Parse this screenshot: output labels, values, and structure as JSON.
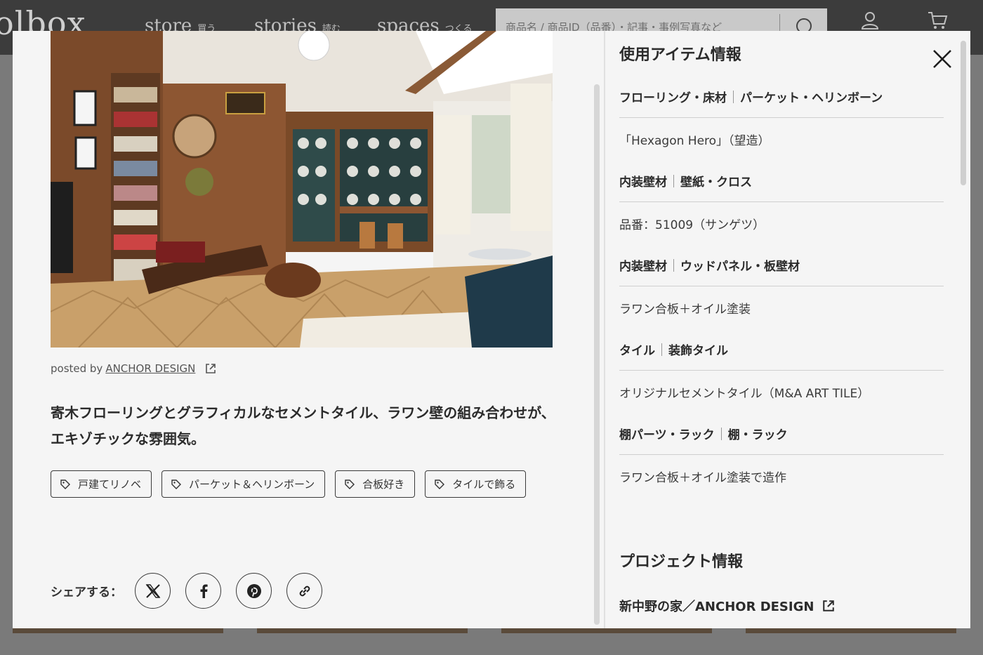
{
  "site": {
    "logo": "olbox",
    "nav": [
      {
        "label": "store",
        "sub": "買う"
      },
      {
        "label": "stories",
        "sub": "読む"
      },
      {
        "label": "spaces",
        "sub": "つくる"
      }
    ],
    "search_placeholder": "商品名 / 商品ID（品番）・記事・事例写真など",
    "icons": [
      "search-icon",
      "user-icon",
      "cart-icon"
    ]
  },
  "post": {
    "posted_prefix": "posted by",
    "author": "ANCHOR DESIGN",
    "caption": "寄木フローリングとグラフィカルなセメントタイル、ラワン壁の組み合わせが、エキゾチックな雰囲気。",
    "tags": [
      "戸建てリノベ",
      "パーケット＆ヘリンボーン",
      "合板好き",
      "タイルで飾る"
    ],
    "share_label": "シェアする：",
    "share_icons": [
      "x-icon",
      "facebook-icon",
      "pinterest-icon",
      "link-icon"
    ]
  },
  "items_section": {
    "title": "使用アイテム情報",
    "items": [
      {
        "category": "フローリング・床材",
        "subcategory": "パーケット・ヘリンボーン",
        "value": "「Hexagon Hero」（望造）"
      },
      {
        "category": "内装壁材",
        "subcategory": "壁紙・クロス",
        "value": "品番：51009（サンゲツ）"
      },
      {
        "category": "内装壁材",
        "subcategory": "ウッドパネル・板壁材",
        "value": "ラワン合板＋オイル塗装"
      },
      {
        "category": "タイル",
        "subcategory": "装飾タイル",
        "value": "オリジナルセメントタイル（M&A ART TILE）"
      },
      {
        "category": "棚パーツ・ラック",
        "subcategory": "棚・ラック",
        "value": "ラワン合板＋オイル塗装で造作"
      }
    ]
  },
  "project_section": {
    "title": "プロジェクト情報",
    "link": "新中野の家／ANCHOR DESIGN"
  },
  "colors": {
    "modal_bg": "#f5f5f5",
    "text": "#2b2b2b",
    "overlay": "#7a7a7a"
  }
}
